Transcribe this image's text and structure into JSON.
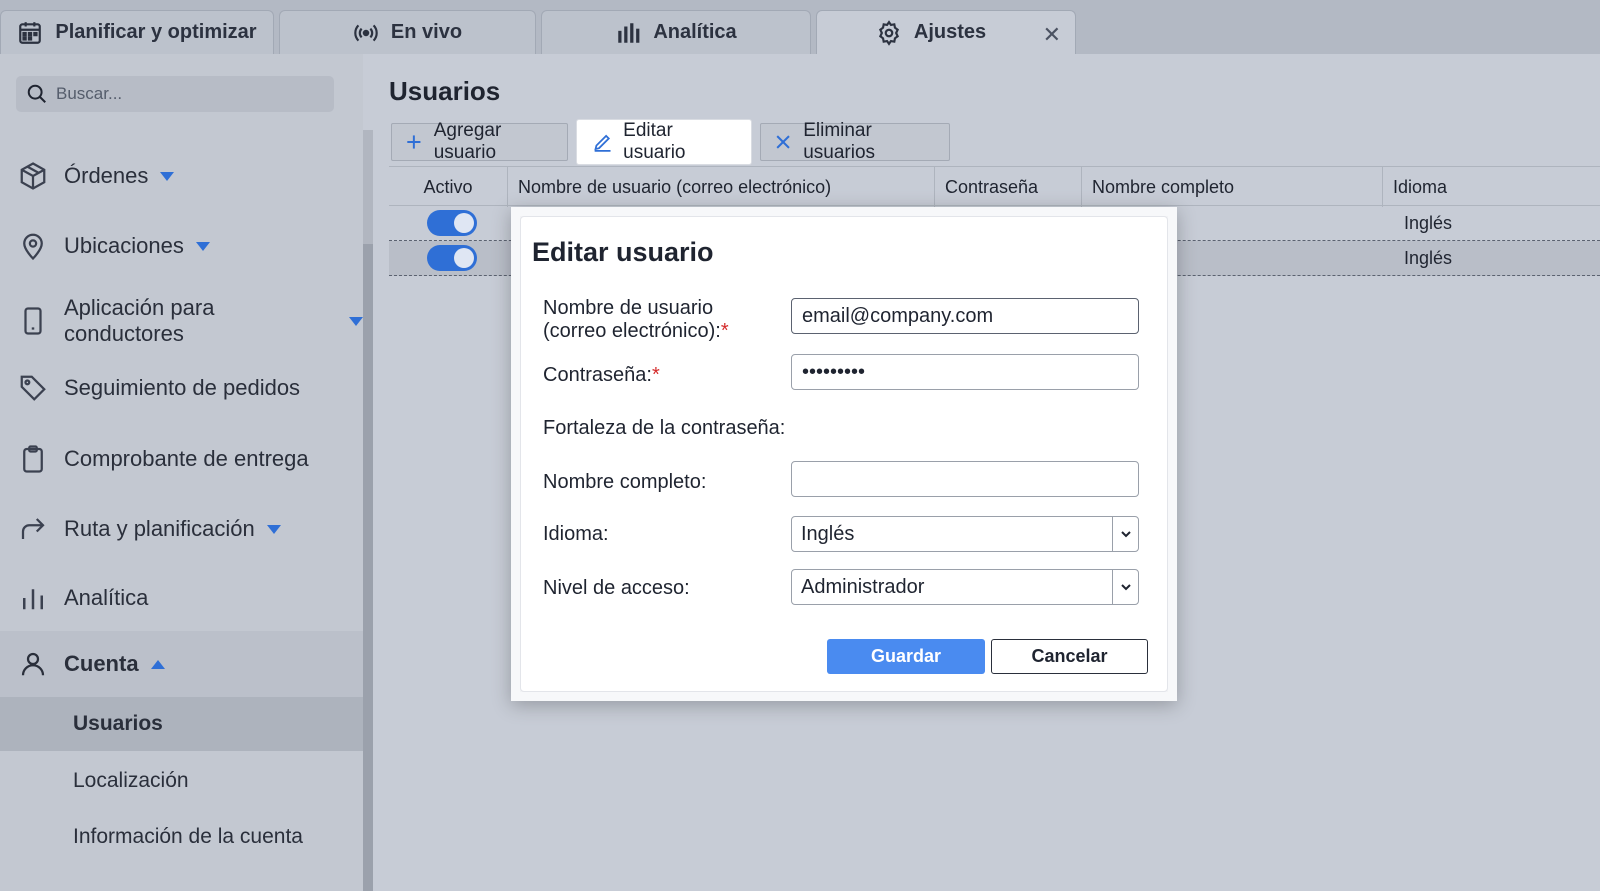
{
  "tabs": [
    {
      "label": "Planificar y optimizar",
      "icon": "calendar-icon"
    },
    {
      "label": "En vivo",
      "icon": "broadcast-icon"
    },
    {
      "label": "Analítica",
      "icon": "bar-chart-icon"
    },
    {
      "label": "Ajustes",
      "icon": "gear-icon",
      "active": true,
      "close": "✕"
    }
  ],
  "sidebar": {
    "search_placeholder": "Buscar...",
    "items": [
      {
        "label": "Órdenes",
        "icon": "package-icon",
        "expandable": true
      },
      {
        "label": "Ubicaciones",
        "icon": "location-pin-icon",
        "expandable": true
      },
      {
        "label": "Aplicación para conductores",
        "icon": "mobile-phone-icon",
        "expandable": true
      },
      {
        "label": "Seguimiento de pedidos",
        "icon": "tag-icon"
      },
      {
        "label": "Comprobante de entrega",
        "icon": "clipboard-icon"
      },
      {
        "label": "Ruta y planificación",
        "icon": "route-arrow-icon",
        "expandable": true
      },
      {
        "label": "Analítica",
        "icon": "bar-chart-icon"
      },
      {
        "label": "Cuenta",
        "icon": "user-icon",
        "expanded": true
      }
    ],
    "sub_items": [
      {
        "label": "Usuarios",
        "active": true
      },
      {
        "label": "Localización"
      },
      {
        "label": "Información de la cuenta"
      }
    ]
  },
  "main": {
    "title": "Usuarios",
    "toolbar": {
      "add": "Agregar usuario",
      "edit": "Editar usuario",
      "delete": "Eliminar usuarios"
    },
    "table": {
      "columns": [
        "Activo",
        "Nombre de usuario (correo electrónico)",
        "Contraseña",
        "Nombre completo",
        "Idioma"
      ],
      "rows": [
        {
          "active": true,
          "language": "Inglés"
        },
        {
          "active": true,
          "language": "Inglés",
          "selected": true
        }
      ]
    }
  },
  "modal": {
    "title": "Editar usuario",
    "username_label_line1": "Nombre de usuario",
    "username_label_line2": "(correo electrónico):",
    "username_value": "email@company.com",
    "password_label": "Contraseña:",
    "password_value": "123456789",
    "strength_label": "Fortaleza de la contraseña:",
    "fullname_label": "Nombre completo:",
    "fullname_value": "",
    "language_label": "Idioma:",
    "language_value": "Inglés",
    "access_label": "Nivel de acceso:",
    "access_value": "Administrador",
    "required_mark": "*",
    "save": "Guardar",
    "cancel": "Cancelar"
  },
  "colors": {
    "accent": "#2f6fd6",
    "save_button": "#4a8bf0",
    "required": "#d42a2a"
  }
}
